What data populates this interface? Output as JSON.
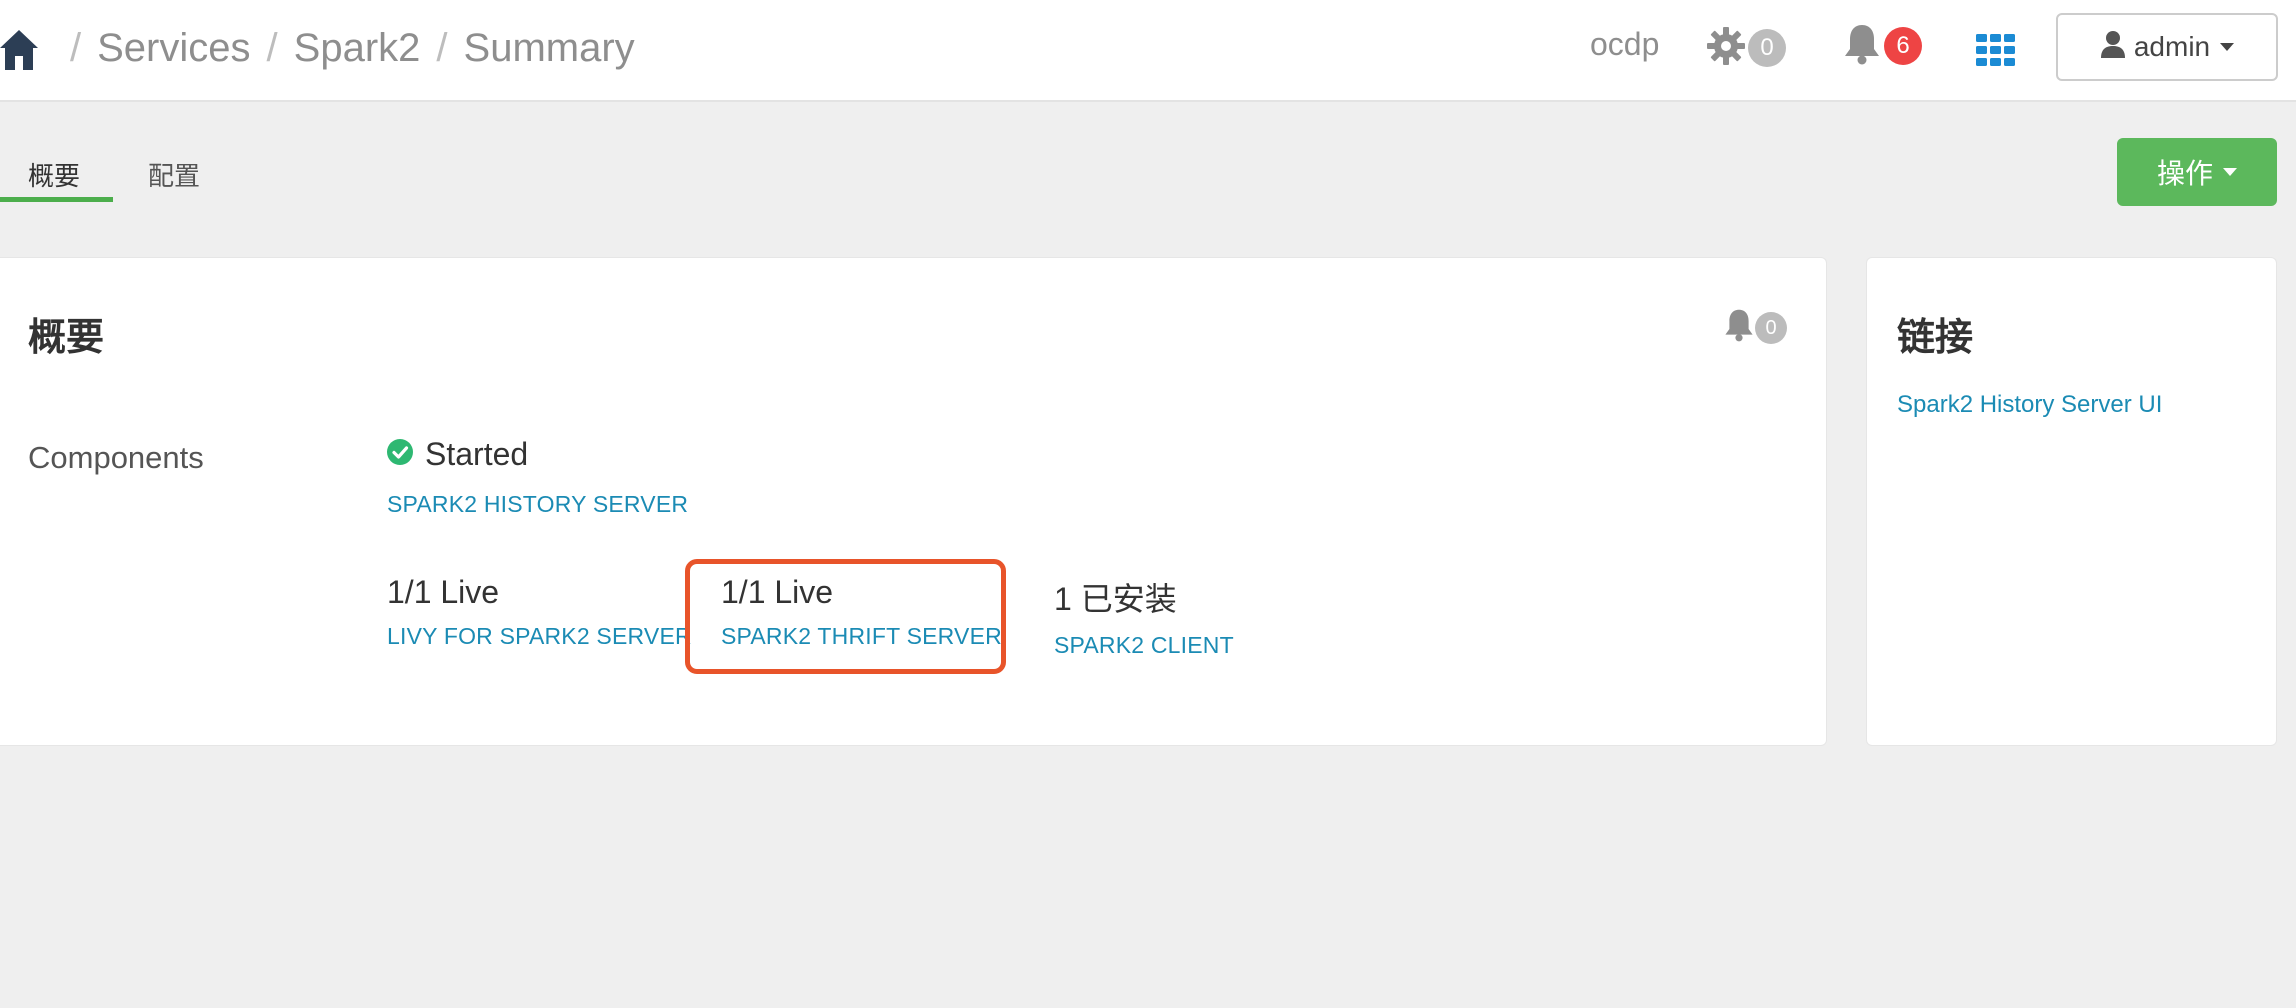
{
  "colors": {
    "accent_green": "#5cb85c",
    "link_blue": "#1b8bb4",
    "alert_red": "#ee4444",
    "highlight_orange": "#e8542a",
    "status_green": "#2eb872"
  },
  "header": {
    "breadcrumb": [
      "Services",
      "Spark2",
      "Summary"
    ],
    "breadcrumb_separator": "/",
    "cluster_name": "ocdp",
    "background_ops_count": "0",
    "alerts_count": "6",
    "user_menu_label": "admin",
    "icons": [
      "home-icon",
      "gear-icon",
      "bell-icon",
      "apps-grid-icon",
      "user-icon"
    ]
  },
  "tabs": [
    {
      "label": "概要",
      "active": true
    },
    {
      "label": "配置",
      "active": false
    }
  ],
  "actions_button_label": "操作",
  "summary": {
    "title": "概要",
    "alerts_count": "0",
    "components_label": "Components",
    "master": {
      "status": "Started",
      "name": "SPARK2 HISTORY SERVER"
    },
    "components": [
      {
        "count": "1/1 Live",
        "name": "LIVY FOR SPARK2 SERVER"
      },
      {
        "count": "1/1 Live",
        "name": "SPARK2 THRIFT SERVER",
        "highlighted": true
      },
      {
        "count": "1 已安装",
        "name": "SPARK2 CLIENT"
      }
    ]
  },
  "links": {
    "title": "链接",
    "items": [
      "Spark2 History Server UI"
    ]
  }
}
